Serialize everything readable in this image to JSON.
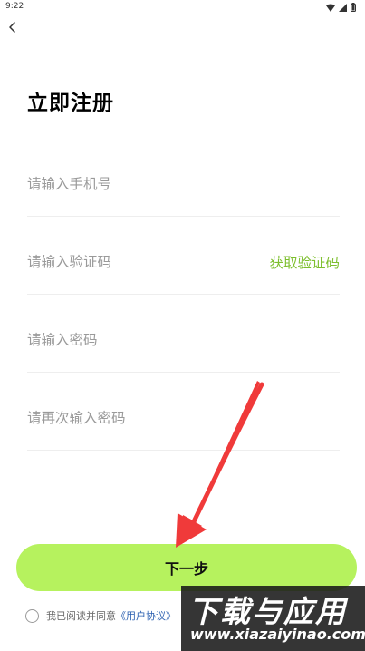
{
  "status_bar": {
    "time": "9:22",
    "icons": [
      "wifi-icon",
      "signal-icon",
      "battery-icon"
    ]
  },
  "header": {
    "back_icon": "chevron-left-icon"
  },
  "title": "立即注册",
  "fields": {
    "phone_placeholder": "请输入手机号",
    "code_placeholder": "请输入验证码",
    "get_code_label": "获取验证码",
    "password_placeholder": "请输入密码",
    "confirm_password_placeholder": "请再次输入密码"
  },
  "next_button_label": "下一步",
  "agreement": {
    "text": "我已阅读并同意",
    "link": "《用户协议》"
  },
  "watermark": {
    "title": "下载与应用",
    "url": "www.xiazaiyinao.com"
  },
  "colors": {
    "accent": "#b6f25e",
    "link_green": "#7dbf2e",
    "link_blue": "#2a5fb0",
    "arrow": "#f03a3a"
  }
}
